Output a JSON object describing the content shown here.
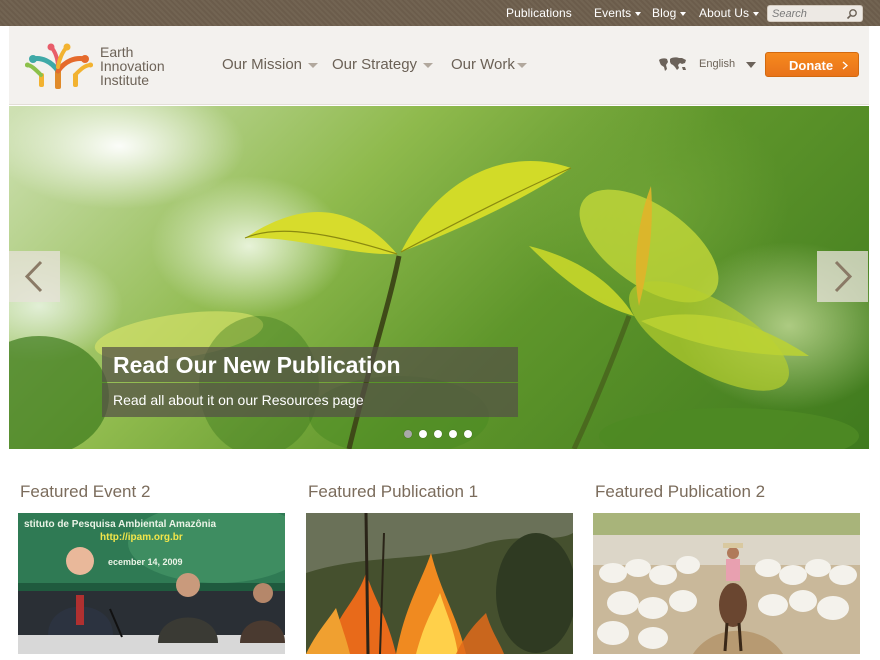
{
  "topbar": {
    "links": [
      "Publications",
      "Events",
      "Blog",
      "About Us"
    ],
    "search_placeholder": "Search"
  },
  "header": {
    "logo_text": [
      "Earth",
      "Innovation",
      "Institute"
    ],
    "nav": [
      "Our Mission",
      "Our Strategy",
      "Our Work"
    ],
    "language": "English",
    "donate_label": "Donate"
  },
  "hero": {
    "title": "Read Our New Publication",
    "subtitle": "Read all about it on our Resources page",
    "slide_count": 5,
    "active_slide": 1
  },
  "featured": [
    {
      "title": "Featured Event 2",
      "image_text": [
        "stituto de Pesquisa Ambiental Amazônia",
        "http://ipam.org.br",
        "ecember 14, 2009"
      ]
    },
    {
      "title": "Featured Publication 1"
    },
    {
      "title": "Featured Publication 2"
    }
  ],
  "colors": {
    "topbar_bg": "#6e5f4d",
    "header_bg": "#f3f1ee",
    "donate_orange": "#f07f1c",
    "text_brown": "#6b6156"
  },
  "icons": [
    "search-icon",
    "globe-map-icon",
    "chevron-right-icon",
    "chevron-left-icon"
  ]
}
